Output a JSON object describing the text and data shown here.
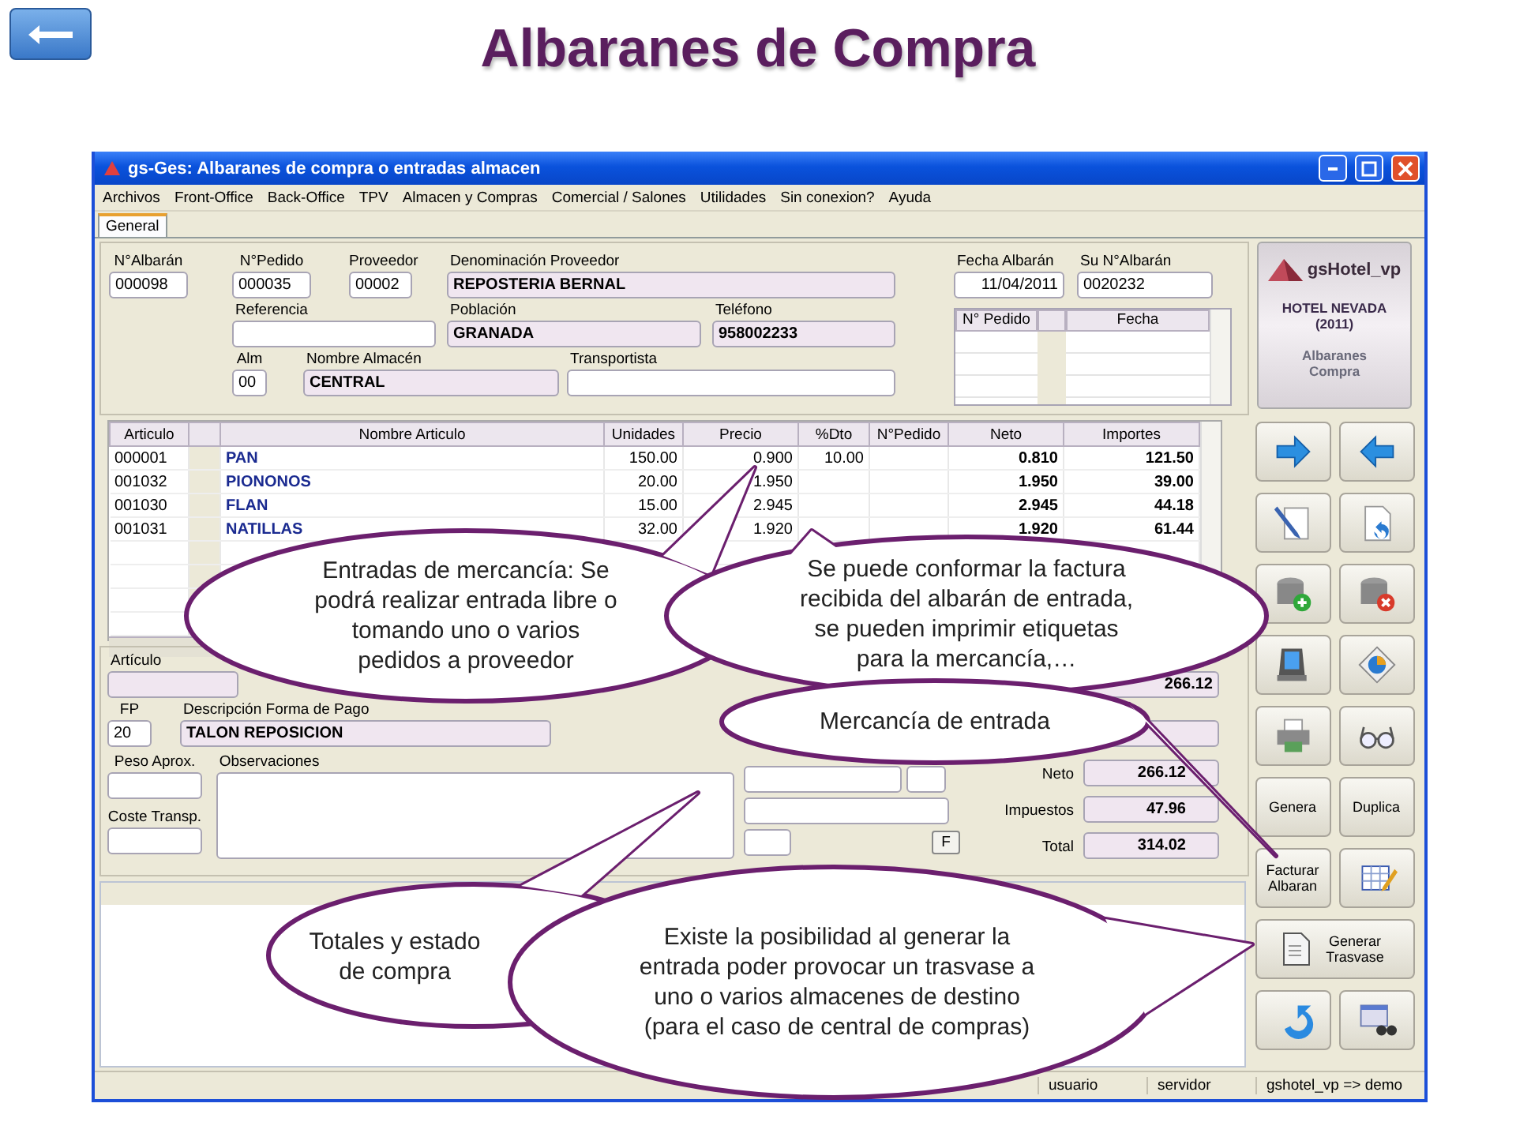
{
  "slide": {
    "title": "Albaranes de Compra"
  },
  "window": {
    "title": "gs-Ges: Albaranes de compra o entradas almacen"
  },
  "menu": [
    "Archivos",
    "Front-Office",
    "Back-Office",
    "TPV",
    "Almacen y Compras",
    "Comercial / Salones",
    "Utilidades",
    "Sin conexion?",
    "Ayuda"
  ],
  "tabs": [
    {
      "label": "General",
      "selected": true
    }
  ],
  "header": {
    "albaran": {
      "label": "N°Albarán",
      "value": "000098"
    },
    "pedido": {
      "label": "N°Pedido",
      "value": "000035"
    },
    "proveedor": {
      "label": "Proveedor",
      "value": "00002"
    },
    "denominacion": {
      "label": "Denominación Proveedor",
      "value": "REPOSTERIA BERNAL"
    },
    "fecha": {
      "label": "Fecha Albarán",
      "value": "11/04/2011"
    },
    "su_albaran": {
      "label": "Su N°Albarán",
      "value": "0020232"
    },
    "referencia": {
      "label": "Referencia"
    },
    "poblacion": {
      "label": "Población",
      "value": "GRANADA"
    },
    "telefono": {
      "label": "Teléfono",
      "value": "958002233"
    },
    "alm": {
      "label": "Alm",
      "value": "00"
    },
    "almacen": {
      "label": "Nombre Almacén",
      "value": "CENTRAL"
    },
    "transportista": {
      "label": "Transportista"
    }
  },
  "orders_table": {
    "columns": [
      "N° Pedido",
      "Fecha"
    ]
  },
  "items": {
    "columns": [
      "Articulo",
      "Nombre Articulo",
      "Unidades",
      "Precio",
      "%Dto",
      "N°Pedido",
      "Neto",
      "Importes"
    ],
    "rows": [
      {
        "articulo": "000001",
        "nombre": "PAN",
        "unidades": "150.00",
        "precio": "0.900",
        "dto": "10.00",
        "neto": "0.810",
        "importe": "121.50"
      },
      {
        "articulo": "001032",
        "nombre": "PIONONOS",
        "unidades": "20.00",
        "precio": "1.950",
        "neto": "1.950",
        "importe": "39.00"
      },
      {
        "articulo": "001030",
        "nombre": "FLAN",
        "unidades": "15.00",
        "precio": "2.945",
        "neto": "2.945",
        "importe": "44.18"
      },
      {
        "articulo": "001031",
        "nombre": "NATILLAS",
        "unidades": "32.00",
        "precio": "1.920",
        "neto": "1.920",
        "importe": "61.44"
      }
    ],
    "total_row": true
  },
  "lower": {
    "articulo": {
      "label": "Artículo"
    },
    "subtotal": "266.12",
    "fp": {
      "label": "FP",
      "value": "20"
    },
    "forma_pago": {
      "label": "Descripción Forma de Pago",
      "value": "TALON REPOSICION"
    },
    "peso": {
      "label": "Peso Aprox."
    },
    "coste": {
      "label": "Coste Transp."
    },
    "observaciones": {
      "label": "Observaciones"
    },
    "f_button": "F",
    "totals": [
      {
        "label": "Neto",
        "value": "266.12"
      },
      {
        "label": "Impuestos",
        "value": "47.96"
      },
      {
        "label": "Total",
        "value": "314.02"
      }
    ]
  },
  "logo": {
    "name": "gsHotel_vp",
    "hotel": "HOTEL NEVADA",
    "year": "(2011)",
    "module": "Albaranes Compra"
  },
  "toolbar": [
    {
      "label": "Genera"
    },
    {
      "label": "Duplica"
    },
    {
      "label": "Facturar Albaran"
    },
    {
      "label": "Generar Trasvase"
    }
  ],
  "status_bar": [
    "usuario",
    "servidor",
    "gshotel_vp => demo"
  ],
  "callouts": [
    {
      "text": "Entradas de mercancía: Se podrá realizar entrada libre o tomando uno o varios pedidos a proveedor"
    },
    {
      "text": "Se puede conformar la factura recibida del albarán de entrada, se pueden imprimir etiquetas para la mercancía,…"
    },
    {
      "text": "Mercancía de entrada"
    },
    {
      "text": "Totales y estado de compra"
    },
    {
      "text": "Existe la posibilidad al generar la entrada poder provocar un trasvase a uno o varios almacenes de destino (para el caso de central de compras)"
    }
  ]
}
